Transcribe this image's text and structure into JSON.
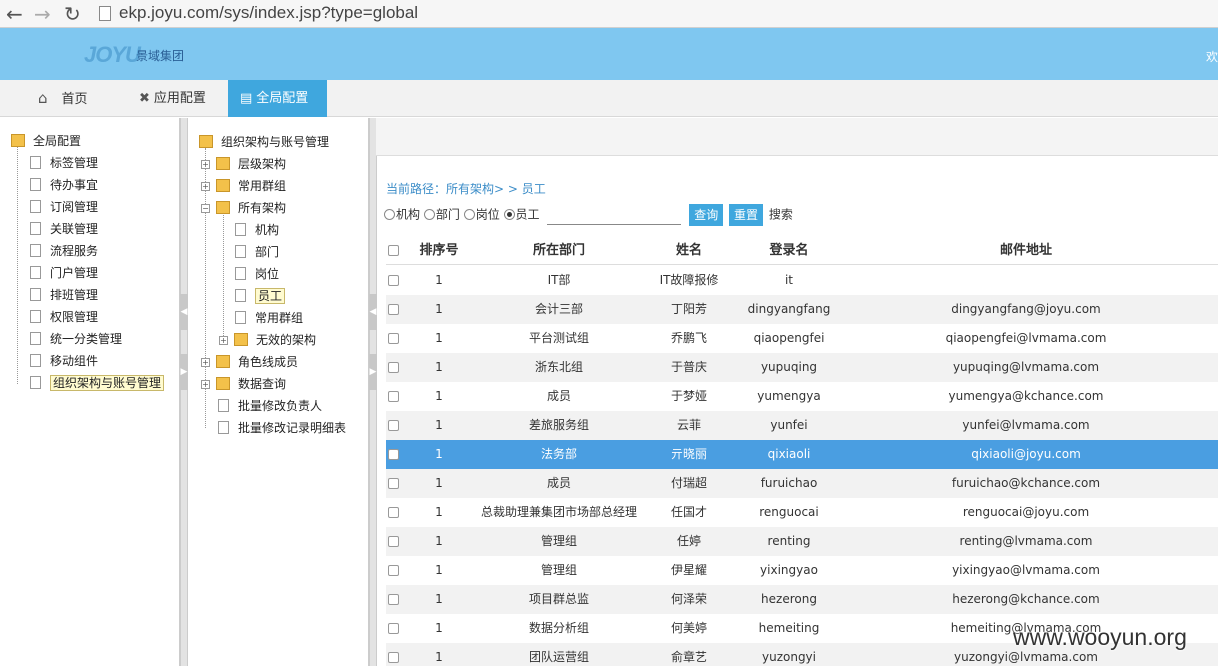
{
  "browser": {
    "url": "ekp.joyu.com/sys/index.jsp?type=global"
  },
  "header": {
    "logo_main": "JOYU",
    "logo_sub": "景域集团",
    "welcome": "欢"
  },
  "topmenu": {
    "home": "首页",
    "app_config": "应用配置",
    "global_config": "全局配置"
  },
  "left_tree": {
    "root": "全局配置",
    "items": [
      "标签管理",
      "待办事宜",
      "订阅管理",
      "关联管理",
      "流程服务",
      "门户管理",
      "排班管理",
      "权限管理",
      "统一分类管理",
      "移动组件",
      "组织架构与账号管理"
    ]
  },
  "mid_tree": {
    "root": "组织架构与账号管理",
    "items": [
      {
        "label": "层级架构"
      },
      {
        "label": "常用群组"
      },
      {
        "label": "所有架构"
      },
      {
        "label": "机构"
      },
      {
        "label": "部门"
      },
      {
        "label": "岗位"
      },
      {
        "label": "员工"
      },
      {
        "label": "常用群组"
      },
      {
        "label": "无效的架构"
      },
      {
        "label": "角色线成员"
      },
      {
        "label": "数据查询"
      },
      {
        "label": "批量修改负责人"
      },
      {
        "label": "批量修改记录明细表"
      }
    ]
  },
  "breadcrumb": "当前路径：所有架构> > 员工",
  "filter": {
    "radios": [
      "机构",
      "部门",
      "岗位",
      "员工"
    ],
    "selected": "员工",
    "search_value": "",
    "query_btn": "查询",
    "reset_btn": "重置",
    "search_label": "搜索"
  },
  "table": {
    "headers": [
      "排序号",
      "所在部门",
      "姓名",
      "登录名",
      "邮件地址"
    ],
    "rows": [
      {
        "no": "1",
        "dept": "IT部",
        "name": "IT故障报修",
        "login": "it",
        "email": ""
      },
      {
        "no": "1",
        "dept": "会计三部",
        "name": "丁阳芳",
        "login": "dingyangfang",
        "email": "dingyangfang@joyu.com"
      },
      {
        "no": "1",
        "dept": "平台测试组",
        "name": "乔鹏飞",
        "login": "qiaopengfei",
        "email": "qiaopengfei@lvmama.com"
      },
      {
        "no": "1",
        "dept": "浙东北组",
        "name": "于普庆",
        "login": "yupuqing",
        "email": "yupuqing@lvmama.com"
      },
      {
        "no": "1",
        "dept": "成员",
        "name": "于梦娅",
        "login": "yumengya",
        "email": "yumengya@kchance.com"
      },
      {
        "no": "1",
        "dept": "差旅服务组",
        "name": "云菲",
        "login": "yunfei",
        "email": "yunfei@lvmama.com"
      },
      {
        "no": "1",
        "dept": "法务部",
        "name": "亓晓丽",
        "login": "qixiaoli",
        "email": "qixiaoli@joyu.com"
      },
      {
        "no": "1",
        "dept": "成员",
        "name": "付瑞超",
        "login": "furuichao",
        "email": "furuichao@kchance.com"
      },
      {
        "no": "1",
        "dept": "总裁助理兼集团市场部总经理",
        "name": "任国才",
        "login": "renguocai",
        "email": "renguocai@joyu.com"
      },
      {
        "no": "1",
        "dept": "管理组",
        "name": "任婷",
        "login": "renting",
        "email": "renting@lvmama.com"
      },
      {
        "no": "1",
        "dept": "管理组",
        "name": "伊星耀",
        "login": "yixingyao",
        "email": "yixingyao@lvmama.com"
      },
      {
        "no": "1",
        "dept": "项目群总监",
        "name": "何泽荣",
        "login": "hezerong",
        "email": "hezerong@kchance.com"
      },
      {
        "no": "1",
        "dept": "数据分析组",
        "name": "何美婷",
        "login": "hemeiting",
        "email": "hemeiting@lvmama.com"
      },
      {
        "no": "1",
        "dept": "团队运营组",
        "name": "俞章艺",
        "login": "yuzongyi",
        "email": "yuzongyi@lvmama.com"
      }
    ]
  },
  "watermark": "www.wooyun.org"
}
